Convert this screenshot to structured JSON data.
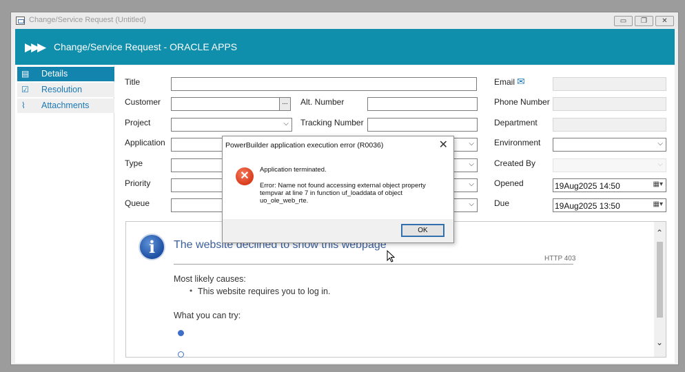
{
  "window": {
    "title": "Change/Service Request (Untitled)",
    "btn_minimize": "▭",
    "btn_restore": "❐",
    "btn_close": "✕"
  },
  "banner": {
    "chevrons": "▶▶▶",
    "title": "Change/Service Request - ORACLE APPS"
  },
  "sidebar": {
    "items": [
      {
        "label": "Details",
        "icon": "details-icon",
        "active": true
      },
      {
        "label": "Resolution",
        "icon": "checklist-icon"
      },
      {
        "label": "Attachments",
        "icon": "paperclip-icon"
      }
    ]
  },
  "form": {
    "title_label": "Title",
    "customer_label": "Customer",
    "customer_ellipsis": "...",
    "project_label": "Project",
    "application_label": "Application",
    "type_label": "Type",
    "priority_label": "Priority",
    "queue_label": "Queue",
    "alt_number_label": "Alt. Number",
    "tracking_number_label": "Tracking Number",
    "email_label": "Email",
    "phone_label": "Phone Number",
    "department_label": "Department",
    "environment_label": "Environment",
    "created_by_label": "Created By",
    "opened_label": "Opened",
    "opened_value": "19Aug2025 14:50",
    "due_label": "Due",
    "due_value": "19Aug2025 13:50"
  },
  "webpage": {
    "heading": "The website declined to show this webpage",
    "http_code": "HTTP 403",
    "causes_heading": "Most likely causes:",
    "cause_1": "This website requires you to log in.",
    "try_heading": "What you can try:"
  },
  "dialog": {
    "title": "PowerBuilder application execution error (R0036)",
    "close": "✕",
    "line_1": "Application terminated.",
    "line_2": "Error: Name not found accessing external object property",
    "line_3": "tempvar at line 7 in function uf_loaddata of object",
    "line_4": "uo_ole_web_rte.",
    "ok_label": "OK"
  }
}
